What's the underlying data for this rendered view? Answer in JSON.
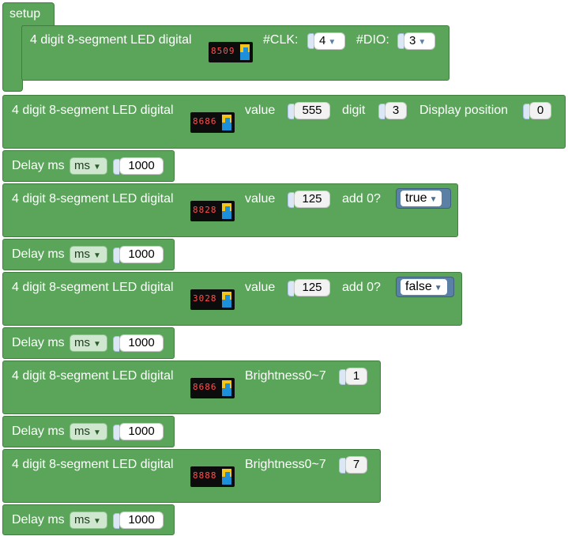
{
  "setup": {
    "hat_label": "setup",
    "init_label": "4 digit 8-segment LED digital",
    "clk_label": "#CLK:",
    "clk_value": "4",
    "dio_label": "#DIO:",
    "dio_value": "3",
    "led_digits": "8509"
  },
  "blocks": {
    "show_number": {
      "label": "4 digit 8-segment LED digital",
      "value_label": "value",
      "value": "555",
      "digit_label": "digit",
      "digit": "3",
      "position_label": "Display position",
      "position": "0",
      "led_digits": "8686"
    },
    "delay1": {
      "label": "Delay ms",
      "unit": "ms",
      "value": "1000"
    },
    "add_zero_true": {
      "label": "4 digit 8-segment LED digital",
      "value_label": "value",
      "value": "125",
      "add_label": "add 0?",
      "bool": "true",
      "led_digits": "8828"
    },
    "delay2": {
      "label": "Delay ms",
      "unit": "ms",
      "value": "1000"
    },
    "add_zero_false": {
      "label": "4 digit 8-segment LED digital",
      "value_label": "value",
      "value": "125",
      "add_label": "add 0?",
      "bool": "false",
      "led_digits": "3028"
    },
    "delay3": {
      "label": "Delay ms",
      "unit": "ms",
      "value": "1000"
    },
    "brightness1": {
      "label": "4 digit 8-segment LED digital",
      "brightness_label": "Brightness0~7",
      "value": "1",
      "led_digits": "8686"
    },
    "delay4": {
      "label": "Delay ms",
      "unit": "ms",
      "value": "1000"
    },
    "brightness7": {
      "label": "4 digit 8-segment LED digital",
      "brightness_label": "Brightness0~7",
      "value": "7",
      "led_digits": "8888"
    },
    "delay5": {
      "label": "Delay ms",
      "unit": "ms",
      "value": "1000"
    }
  },
  "icons": {
    "dropdown": "triangle-down",
    "module": "led-module-image"
  },
  "colors": {
    "block": "#5ba55b",
    "logic": "#5b80a5",
    "led_segment": "#ff5050"
  }
}
